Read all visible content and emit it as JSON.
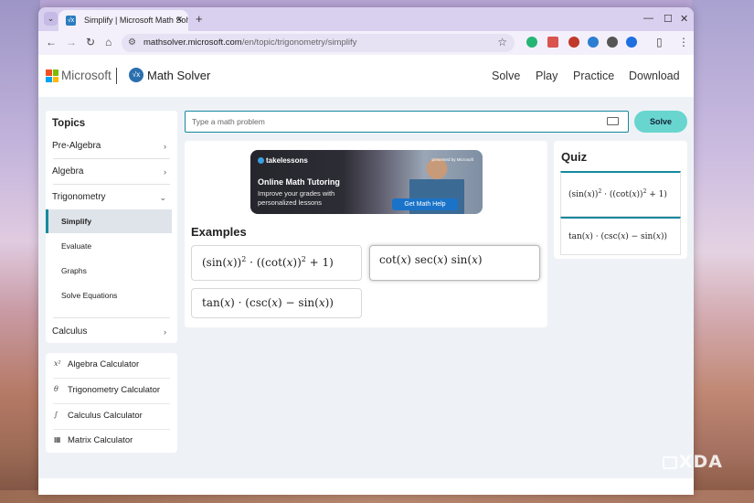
{
  "browser": {
    "tab_title": "Simplify | Microsoft Math Solver",
    "favicon": "√x",
    "url_host": "mathsolver.microsoft.com",
    "url_path": "/en/topic/trigonometry/simplify"
  },
  "header": {
    "brand": "Microsoft",
    "app_name": "Math Solver",
    "nav": [
      "Solve",
      "Play",
      "Practice",
      "Download"
    ]
  },
  "sidebar": {
    "title": "Topics",
    "topics": [
      "Pre-Algebra",
      "Algebra",
      "Trigonometry",
      "Calculus"
    ],
    "subtopics": [
      "Simplify",
      "Evaluate",
      "Graphs",
      "Solve Equations"
    ],
    "active_subtopic": "Simplify"
  },
  "calculators": [
    {
      "icon": "x²",
      "label": "Algebra Calculator"
    },
    {
      "icon": "θ",
      "label": "Trigonometry Calculator"
    },
    {
      "icon": "∫",
      "label": "Calculus Calculator"
    },
    {
      "icon": "▦",
      "label": "Matrix Calculator"
    }
  ],
  "search": {
    "placeholder": "Type a math problem",
    "button_label": "Solve"
  },
  "ad": {
    "brand": "takelessons",
    "presented_by": "presented by Microsoft",
    "title": "Online Math Tutoring",
    "subtitle": "Improve your grades with personalized lessons",
    "cta": "Get Math Help"
  },
  "examples": {
    "title": "Examples"
  },
  "quiz": {
    "title": "Quiz"
  },
  "watermark": "XDA"
}
